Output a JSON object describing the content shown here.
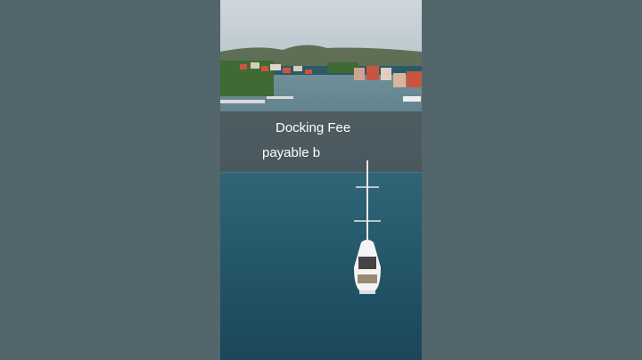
{
  "caption": {
    "line1": "Docking Fee",
    "line2": "payable b"
  },
  "colors": {
    "side_panel": "#52666b",
    "caption_band": "#464e50",
    "sea": "#1f4f63",
    "roofs": "#c9553f"
  }
}
